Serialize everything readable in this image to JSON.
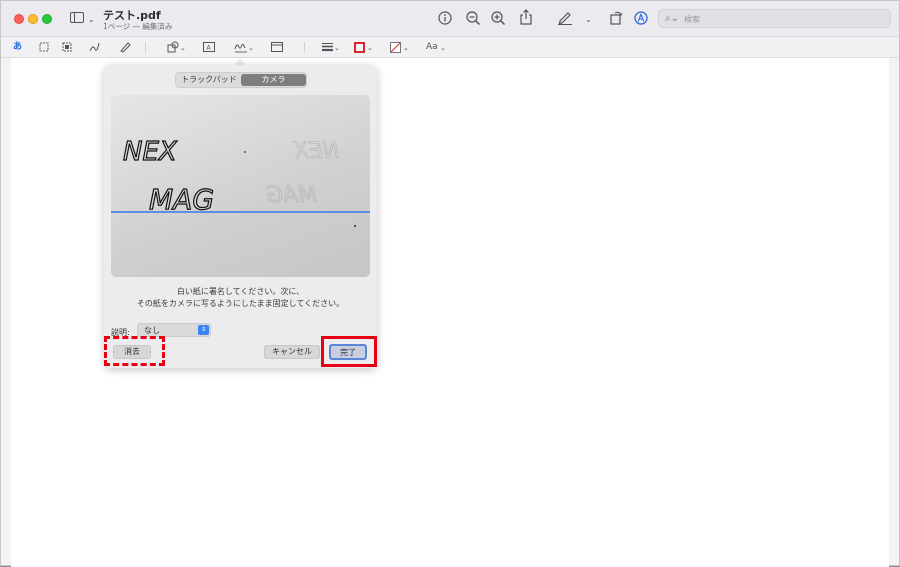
{
  "window": {
    "title": "テスト.pdf",
    "subtitle": "1ページ — 編集済み"
  },
  "toolbar": {
    "search_placeholder": "検索",
    "icons": [
      "info-icon",
      "zoom-out-icon",
      "zoom-in-icon",
      "share-icon",
      "markup-pen-icon",
      "rotate-icon",
      "annotate-icon"
    ]
  },
  "markup_toolbar": {
    "text_selection_label": "あ",
    "font_label": "Aa",
    "border_color": "#d7262e",
    "fill_color": "#e23a3a"
  },
  "signature_popover": {
    "tabs": [
      {
        "label": "トラックパッド",
        "selected": false
      },
      {
        "label": "カメラ",
        "selected": true
      }
    ],
    "camera_preview": {
      "signature_text_line1": "NEX",
      "signature_text_line2": "MAG",
      "mirrored_text_line1": "NEX",
      "mirrored_text_line2": "MAG"
    },
    "instruction_line1": "白い紙に署名してください。次に、",
    "instruction_line2": "その紙をカメラに写るようにしたまま固定してください。",
    "description_label": "説明:",
    "description_value": "なし",
    "clear_label": "消去",
    "cancel_label": "キャンセル",
    "done_label": "完了"
  },
  "colors": {
    "highlight": "#e60012",
    "accent": "#3b82f6",
    "guide_line": "#5b8fe2"
  }
}
